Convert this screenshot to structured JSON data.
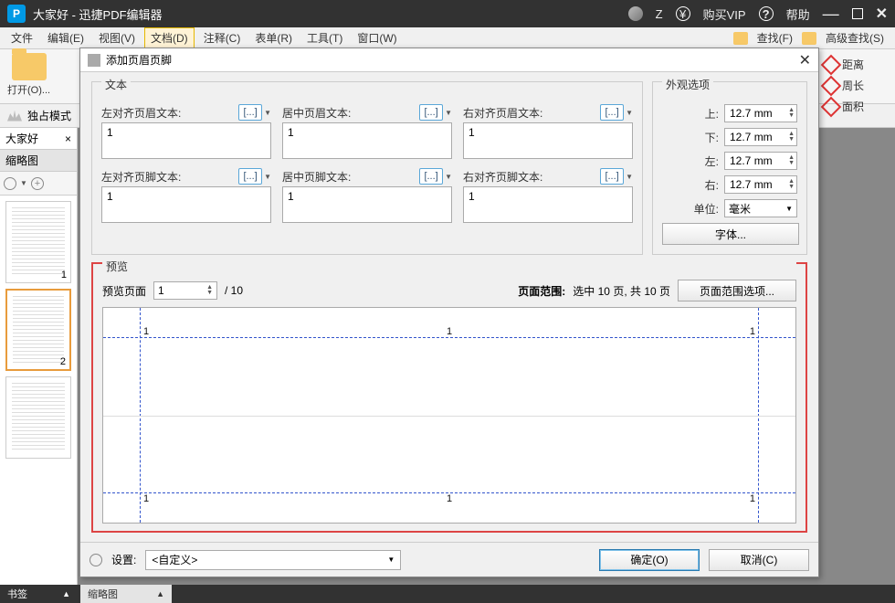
{
  "titlebar": {
    "title": "大家好 - 迅捷PDF编辑器",
    "user_letter": "Z",
    "vip": "购买VIP",
    "help": "帮助"
  },
  "menubar": {
    "items": [
      "文件",
      "编辑(E)",
      "视图(V)",
      "文档(D)",
      "注释(C)",
      "表单(R)",
      "工具(T)",
      "窗口(W)"
    ],
    "find": "查找(F)",
    "advfind": "高级查找(S)"
  },
  "toolbar": {
    "open": "打开(O)..."
  },
  "right_tools": {
    "distance": "距离",
    "perimeter": "周长",
    "area": "面积"
  },
  "exclusive": "独占模式",
  "doc_tab": "大家好",
  "thumbnail_panel": {
    "title": "缩略图",
    "pages": [
      1,
      2
    ]
  },
  "bookmark_tab": "书签",
  "secondary_tab": "缩略图",
  "dialog": {
    "title": "添加页眉页脚",
    "text_group": "文本",
    "fields": {
      "header_left": {
        "label": "左对齐页眉文本:",
        "value": "1"
      },
      "header_center": {
        "label": "居中页眉文本:",
        "value": "1"
      },
      "header_right": {
        "label": "右对齐页眉文本:",
        "value": "1"
      },
      "footer_left": {
        "label": "左对齐页脚文本:",
        "value": "1"
      },
      "footer_center": {
        "label": "居中页脚文本:",
        "value": "1"
      },
      "footer_right": {
        "label": "右对齐页脚文本:",
        "value": "1"
      }
    },
    "dots": "[...]",
    "appearance_group": "外观选项",
    "margins": {
      "top": {
        "label": "上:",
        "value": "12.7 mm"
      },
      "bottom": {
        "label": "下:",
        "value": "12.7 mm"
      },
      "left": {
        "label": "左:",
        "value": "12.7 mm"
      },
      "right": {
        "label": "右:",
        "value": "12.7 mm"
      }
    },
    "unit_label": "单位:",
    "unit_value": "毫米",
    "font_btn": "字体...",
    "preview_group": "预览",
    "preview_page_label": "预览页面",
    "preview_page_value": "1",
    "preview_total": "/ 10",
    "page_range_label": "页面范围:",
    "page_range_value": "选中 10 页, 共 10 页",
    "page_range_btn": "页面范围选项...",
    "preview_marks": {
      "tl": "1",
      "tc": "1",
      "tr": "1",
      "bl": "1",
      "bc": "1",
      "br": "1"
    },
    "settings_label": "设置:",
    "settings_value": "<自定义>",
    "ok": "确定(O)",
    "cancel": "取消(C)"
  }
}
